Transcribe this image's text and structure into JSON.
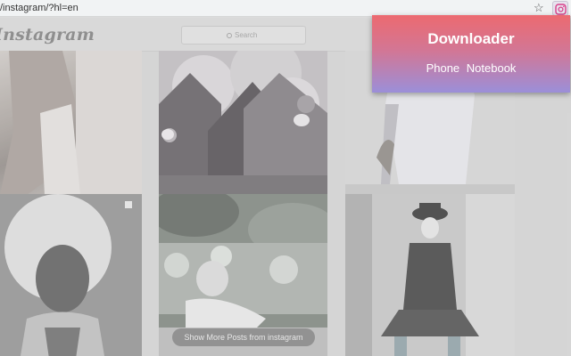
{
  "browser": {
    "url": "/instagram/?hl=en",
    "star_icon": "star-icon",
    "extension_icon": "instagram-icon"
  },
  "instagram": {
    "logo": "Instagram",
    "search_placeholder": "Search",
    "show_more": "Show More Posts from instagram"
  },
  "popup": {
    "title": "Downloader",
    "options": [
      "Phone",
      "Notebook"
    ],
    "colors": {
      "top": "#ec6a70",
      "bottom": "#9b8fd9"
    }
  }
}
